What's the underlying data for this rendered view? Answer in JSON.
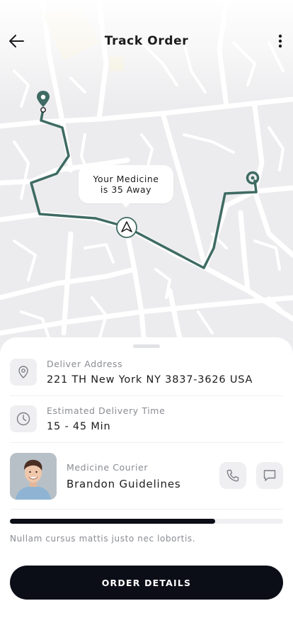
{
  "header": {
    "title": "Track Order",
    "back_icon": "arrow-left-icon",
    "menu_icon": "more-vertical-icon"
  },
  "map": {
    "bubble_text": "Your Medicine\nis 35 Away",
    "route_color": "#3e6b63",
    "courier_marker_icon": "navigation-arrow-icon",
    "origin_pin_icon": "map-pin-icon",
    "destination_pin_icon": "map-pin-icon"
  },
  "details": {
    "address": {
      "icon": "location-pin-icon",
      "label": "Deliver Address",
      "value": "221 TH New York NY 3837-3626 USA"
    },
    "time": {
      "icon": "clock-icon",
      "label": "Estimated Delivery Time",
      "value": "15 - 45 Min"
    },
    "courier": {
      "label": "Medicine Courier",
      "name": "Brandon Guidelines",
      "call_icon": "phone-icon",
      "chat_icon": "chat-bubble-icon"
    }
  },
  "progress": {
    "fraction": 0.75,
    "note": "Nullam cursus mattis justo nec lobortis."
  },
  "cta": {
    "label": "ORDER DETAILS"
  },
  "colors": {
    "accent_dark": "#0b0d17",
    "route": "#3e6b63",
    "muted_text": "#8a8c92"
  }
}
